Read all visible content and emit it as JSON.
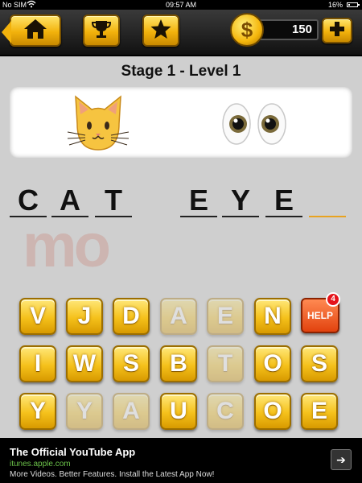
{
  "status_bar": {
    "carrier": "No SIM",
    "time": "09:57 AM",
    "battery_percent": "16%",
    "battery_level": 0.16
  },
  "top_bar": {
    "home_icon": "home-icon",
    "trophy_icon": "trophy-icon",
    "star_icon": "star-icon",
    "coin_symbol": "$",
    "coins": "150",
    "plus_label": "+"
  },
  "game": {
    "title": "Stage 1 - Level 1",
    "clue_emojis": [
      "cat-face",
      "eyes"
    ],
    "answer_letters": [
      "C",
      "A",
      "T",
      "E",
      "Y",
      "E"
    ],
    "answer_slots": 7,
    "watermark": "mo"
  },
  "keyboard": {
    "rows": [
      [
        {
          "l": "V",
          "used": false
        },
        {
          "l": "J",
          "used": false
        },
        {
          "l": "D",
          "used": false
        },
        {
          "l": "A",
          "used": true
        },
        {
          "l": "E",
          "used": true
        },
        {
          "l": "N",
          "used": false
        }
      ],
      [
        {
          "l": "I",
          "used": false
        },
        {
          "l": "W",
          "used": false
        },
        {
          "l": "S",
          "used": false
        },
        {
          "l": "B",
          "used": false
        },
        {
          "l": "T",
          "used": true
        },
        {
          "l": "O",
          "used": false
        },
        {
          "l": "S",
          "used": false
        }
      ],
      [
        {
          "l": "Y",
          "used": false
        },
        {
          "l": "Y",
          "used": true
        },
        {
          "l": "A",
          "used": true
        },
        {
          "l": "U",
          "used": false
        },
        {
          "l": "C",
          "used": true
        },
        {
          "l": "O",
          "used": false
        },
        {
          "l": "E",
          "used": false
        }
      ]
    ],
    "help_label": "HELP",
    "help_count": "4"
  },
  "ad": {
    "title": "The Official YouTube App",
    "url": "itunes.apple.com",
    "description": "More Videos. Better Features. Install the Latest App Now!",
    "arrow_icon": "arrow-right-icon"
  },
  "colors": {
    "gold": "#f5c11b",
    "help_orange": "#e2420e",
    "ad_url_green": "#6bc24a"
  }
}
